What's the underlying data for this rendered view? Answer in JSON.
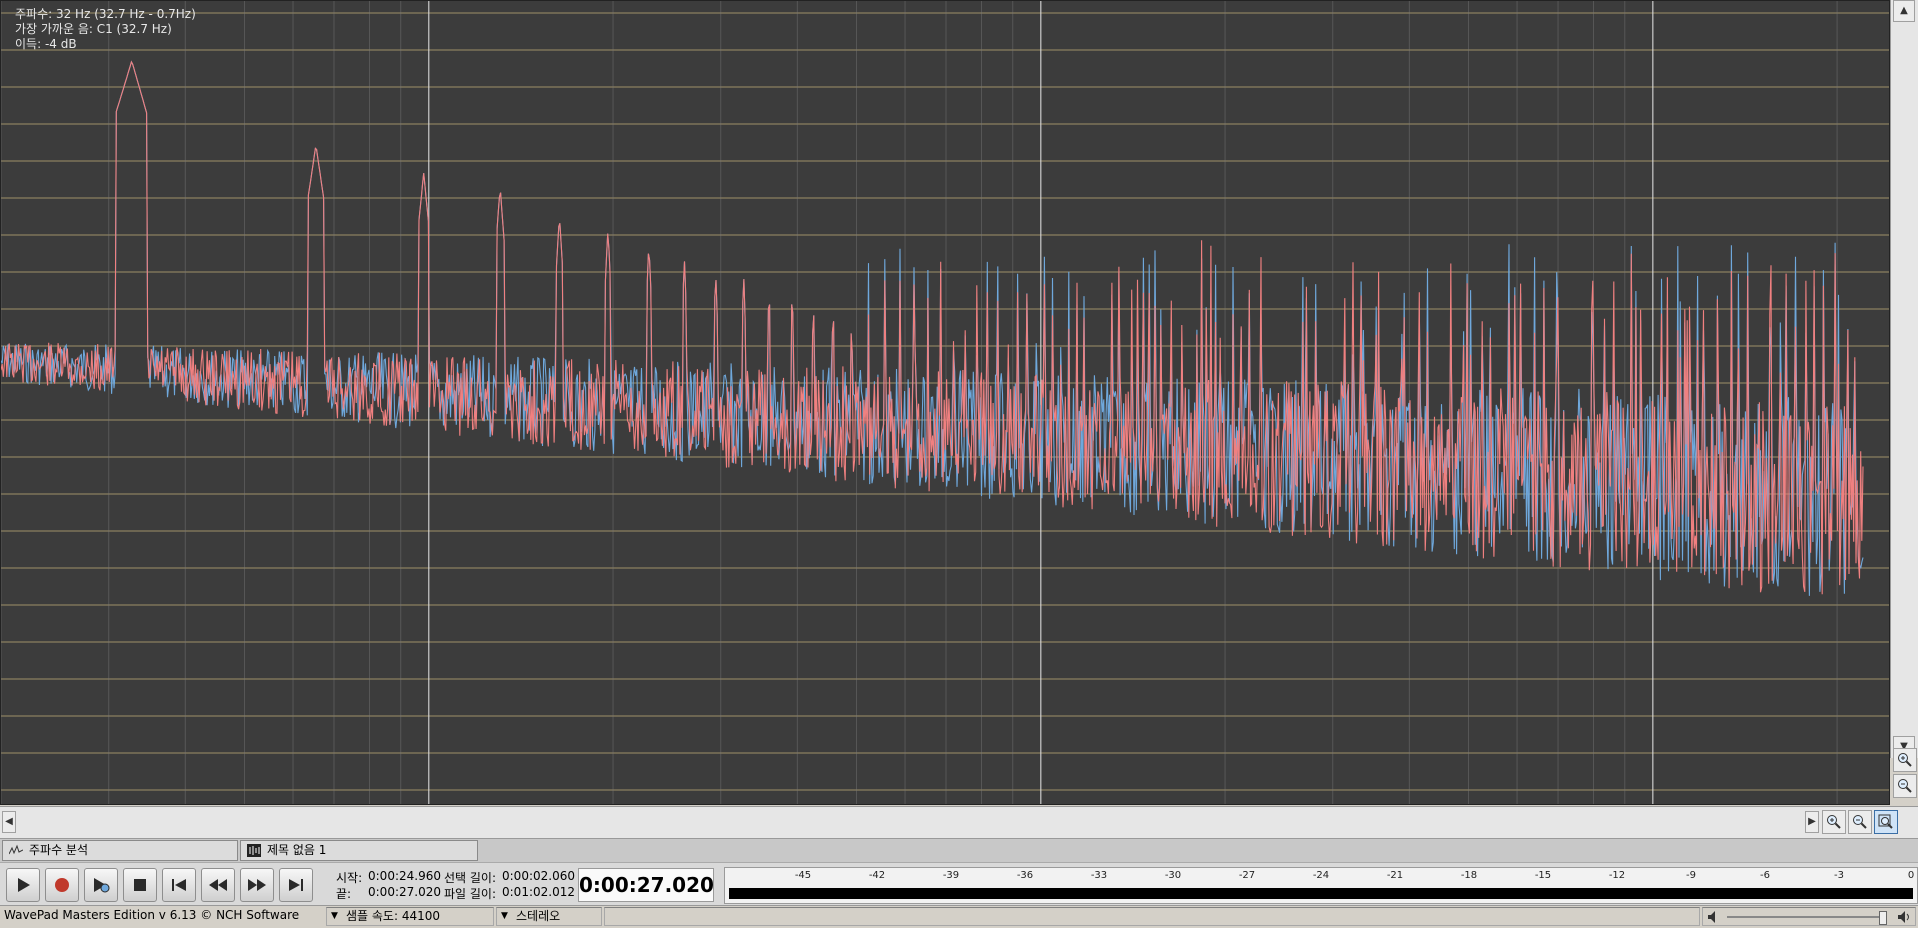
{
  "readout": {
    "frequency": "주파수: 32 Hz (32.7 Hz - 0.7Hz)",
    "nearest_note": "가장 가까운 음: C1 (32.7 Hz)",
    "gain": "이득: -4 dB"
  },
  "tabs": [
    {
      "label": "주파수 분석",
      "icon": "spectrum-icon"
    },
    {
      "label": "제목 없음 1",
      "icon": "waveform-icon"
    }
  ],
  "transport": {
    "buttons": [
      {
        "name": "play-button",
        "icon": "play-icon"
      },
      {
        "name": "record-button",
        "icon": "record-icon"
      },
      {
        "name": "scrub-button",
        "icon": "scrub-icon"
      },
      {
        "name": "stop-button",
        "icon": "stop-icon"
      },
      {
        "name": "go-to-start-button",
        "icon": "skip-start-icon"
      },
      {
        "name": "rewind-button",
        "icon": "rewind-icon"
      },
      {
        "name": "fast-forward-button",
        "icon": "fast-forward-icon"
      },
      {
        "name": "go-to-end-button",
        "icon": "skip-end-icon"
      }
    ],
    "start_label": "시작:",
    "start_value": "0:00:24.960",
    "end_label": "끝:",
    "end_value": "0:00:27.020",
    "selection_length_label": "선택 길이:",
    "selection_length_value": "0:00:02.060",
    "file_length_label": "파일 길이:",
    "file_length_value": "0:01:02.012",
    "current_time": "0:00:27.020"
  },
  "level_meter": {
    "ticks": [
      "-45",
      "-42",
      "-39",
      "-36",
      "-33",
      "-30",
      "-27",
      "-24",
      "-21",
      "-18",
      "-15",
      "-12",
      "-9",
      "-6",
      "-3",
      "0"
    ],
    "level": 0
  },
  "statusbar": {
    "app": "WavePad Masters Edition v 6.13 © NCH Software",
    "sample_rate": "샘플 속도: 44100",
    "channels": "스테레오",
    "volume": 1.0
  },
  "colors": {
    "plot_bg": "#3c3c3c",
    "grid_major": "#dcdcdc",
    "grid_minor": "#7a7a7a",
    "grid_horizontal": "#c8b27a",
    "left_channel": "#6fa8dc",
    "right_channel": "#f08080"
  },
  "chart_data": {
    "type": "line",
    "title": "",
    "xlabel": "",
    "ylabel": "",
    "x_scale": "log",
    "grid": true,
    "series": [
      {
        "channel": "left",
        "color": "#6fa8dc",
        "description_of_points": "frequency spectrum (Hz vs relative level)",
        "x": [],
        "y": []
      },
      {
        "channel": "right",
        "color": "#f08080",
        "x": [],
        "y": []
      }
    ],
    "peaks_hz": [
      32.7,
      65,
      98,
      131,
      163,
      196,
      229,
      262,
      294,
      327,
      360,
      392,
      425,
      458,
      490
    ],
    "peak_levels_db": [
      -4,
      -10,
      -12,
      -13,
      -15,
      -16,
      -17,
      -18,
      -19,
      -19,
      -20,
      -20,
      -21,
      -21,
      -22
    ]
  }
}
